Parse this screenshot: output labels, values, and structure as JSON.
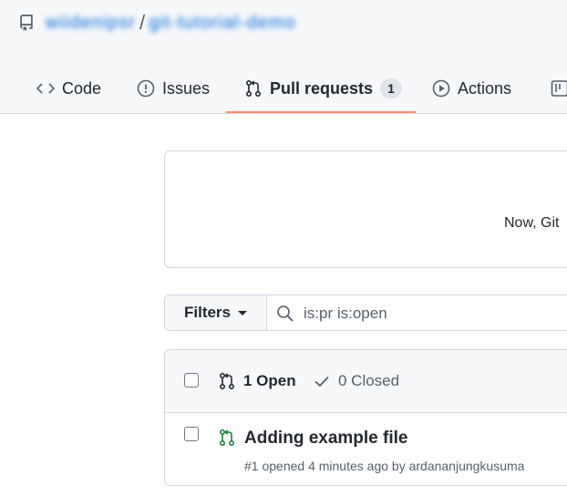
{
  "repo": {
    "owner": "wiidenipsr",
    "separator": "/",
    "name": "git-tutorial-demo"
  },
  "tabs": [
    {
      "label": "Code",
      "icon": "code-icon"
    },
    {
      "label": "Issues",
      "icon": "issue-opened-icon"
    },
    {
      "label": "Pull requests",
      "icon": "git-pull-request-icon",
      "counter": "1",
      "selected": true
    },
    {
      "label": "Actions",
      "icon": "play-icon"
    },
    {
      "label": "",
      "icon": "project-icon"
    }
  ],
  "banner": {
    "text": "Now, Git"
  },
  "filters": {
    "button_label": "Filters",
    "search_value": "is:pr is:open"
  },
  "list": {
    "open_label": "1 Open",
    "closed_label": "0 Closed",
    "items": [
      {
        "title": "Adding example file",
        "meta": "#1 opened 4 minutes ago by ardananjungkusuma"
      }
    ]
  },
  "colors": {
    "accent_underline": "#fd8c73",
    "open_green": "#1a7f37",
    "link_blue": "#0969da"
  }
}
